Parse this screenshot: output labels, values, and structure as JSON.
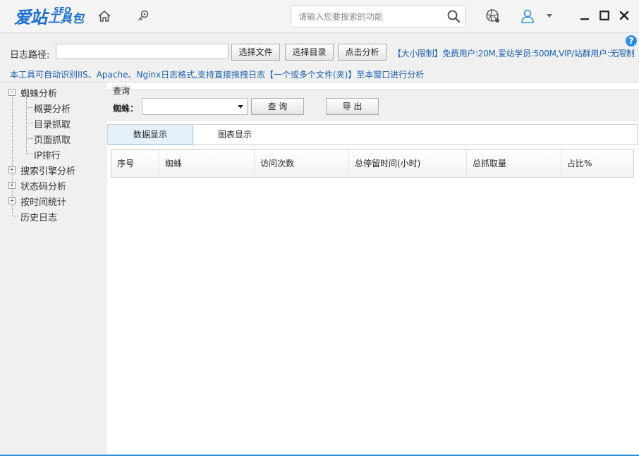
{
  "app": {
    "logo_main": "爱站",
    "logo_sub": "工具包",
    "logo_seo": "SEO"
  },
  "search": {
    "placeholder": "请输入您要搜索的功能"
  },
  "help_label": "?",
  "path": {
    "label": "日志路径:",
    "value": "",
    "choose_file": "选择文件",
    "choose_dir": "选择目录",
    "analyze": "点击分析"
  },
  "limit_text": "【大小限制】免费用户:20M,爱站学员:500M,VIP/站群用户:无限制",
  "notice_text": "本工具可自动识别IIS、Apache、Nginx日志格式,支持直接拖拽日志【一个或多个文件(夹)】至本窗口进行分析",
  "sidebar": {
    "group1": "蜘蛛分析",
    "group1_items": [
      "概要分析",
      "目录抓取",
      "页面抓取",
      "IP排行"
    ],
    "group2": "搜索引擎分析",
    "group3": "状态码分析",
    "group4": "按时间统计",
    "group5": "历史日志"
  },
  "query": {
    "title": "查询",
    "spider_label": "蜘蛛：",
    "spider_value": "",
    "query_button": "查  询",
    "export_button": "导  出"
  },
  "tabs": [
    "数据显示",
    "图表显示"
  ],
  "table": {
    "columns": [
      "序号",
      "蜘蛛",
      "访问次数",
      "总停留时间(小时)",
      "总抓取量",
      "占比%"
    ],
    "rows": []
  },
  "colors": {
    "brand": "#1e6fd0",
    "link_text": "#1a5fb0",
    "active_tab": "#e4f1fb",
    "accent_line": "#2a8fd8"
  }
}
